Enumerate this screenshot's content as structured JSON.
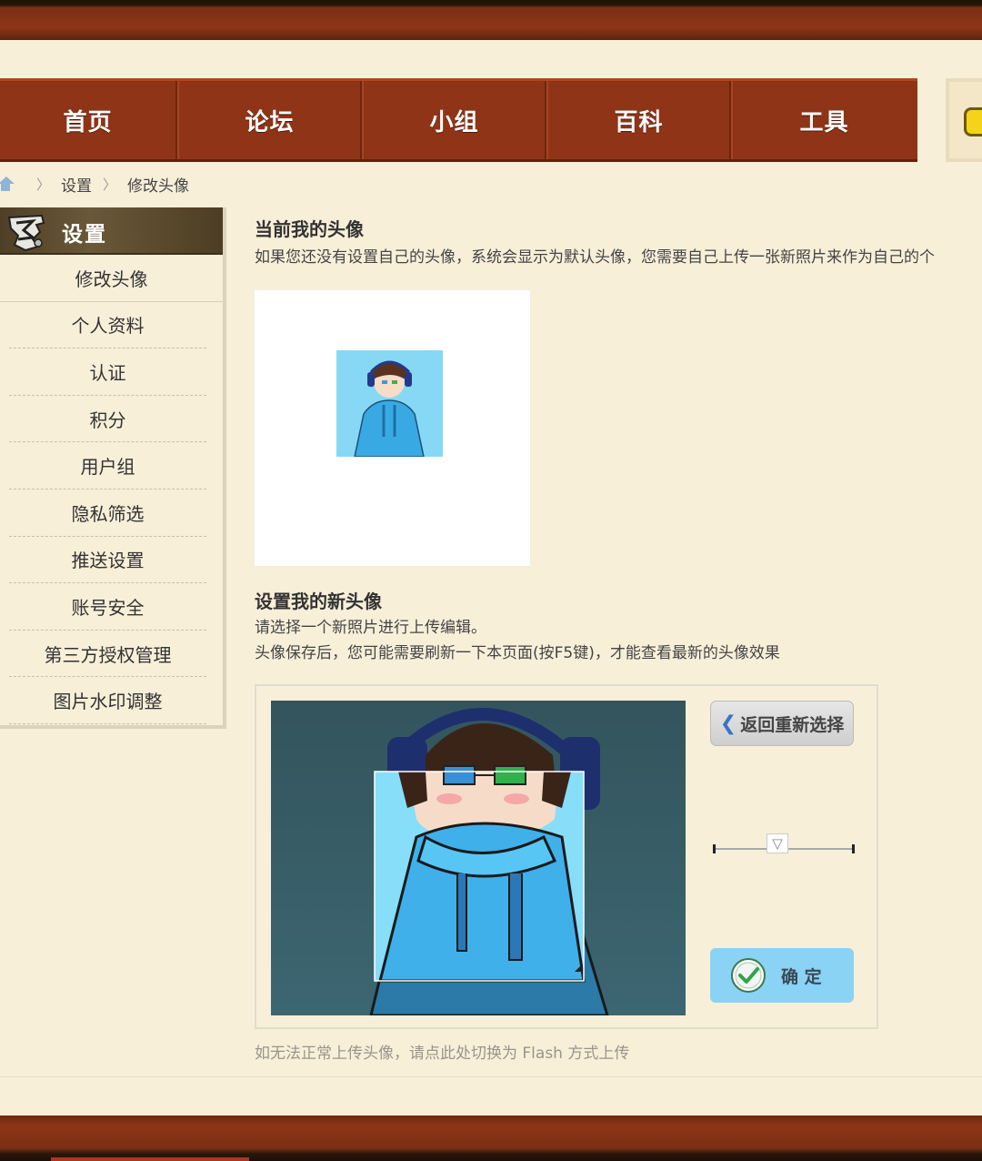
{
  "nav": {
    "items": [
      {
        "label": "首页"
      },
      {
        "label": "论坛"
      },
      {
        "label": "小组"
      },
      {
        "label": "百科"
      },
      {
        "label": "工具"
      }
    ]
  },
  "breadcrumb": {
    "items": [
      "设置",
      "修改头像"
    ],
    "separator": "〉"
  },
  "sidebar": {
    "title": "设置",
    "items": [
      {
        "label": "修改头像",
        "active": true
      },
      {
        "label": "个人资料"
      },
      {
        "label": "认证"
      },
      {
        "label": "积分"
      },
      {
        "label": "用户组"
      },
      {
        "label": "隐私筛选"
      },
      {
        "label": "推送设置"
      },
      {
        "label": "账号安全"
      },
      {
        "label": "第三方授权管理"
      },
      {
        "label": "图片水印调整"
      }
    ]
  },
  "current": {
    "title": "当前我的头像",
    "desc": "如果您还没有设置自己的头像，系统会显示为默认头像，您需要自己上传一张新照片来作为自己的个"
  },
  "new_avatar": {
    "title": "设置我的新头像",
    "line1": "请选择一个新照片进行上传编辑。",
    "line2": "头像保存后，您可能需要刷新一下本页面(按F5键)，才能查看最新的头像效果"
  },
  "editor": {
    "back_label": "返回重新选择",
    "slider_knob": "▽",
    "slider_level": 0.45,
    "ok_label": "确 定"
  },
  "flash_link": "如无法正常上传头像，请点此处切换为 Flash 方式上传",
  "colors": {
    "nav_bg": "#8f3417",
    "page_bg": "#f8efd9",
    "ok_button": "#8ad3f4"
  }
}
